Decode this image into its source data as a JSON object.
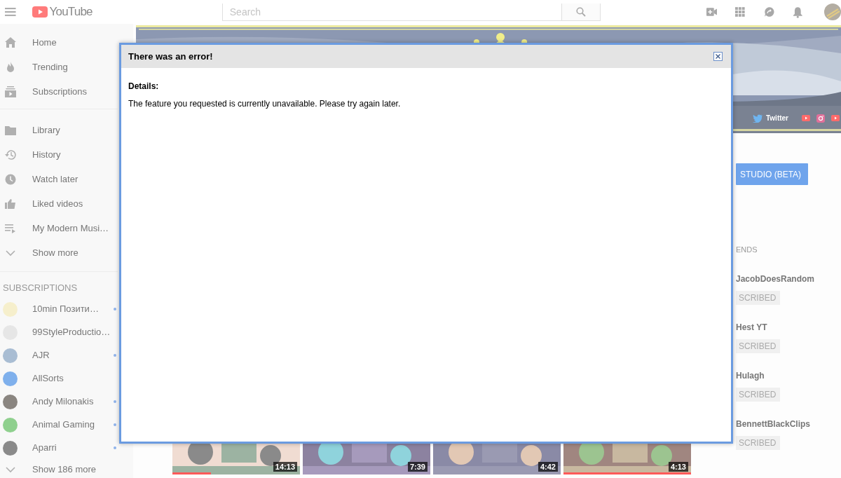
{
  "header": {
    "logo": "YouTube",
    "search_placeholder": "Search"
  },
  "sidebar": {
    "sections": [
      {
        "items": [
          {
            "kind": "home",
            "label": "Home"
          },
          {
            "kind": "trending",
            "label": "Trending"
          },
          {
            "kind": "subscriptions",
            "label": "Subscriptions"
          }
        ]
      },
      {
        "items": [
          {
            "kind": "library",
            "label": "Library"
          },
          {
            "kind": "history",
            "label": "History"
          },
          {
            "kind": "watch_later",
            "label": "Watch later"
          },
          {
            "kind": "liked",
            "label": "Liked videos"
          },
          {
            "kind": "playlist",
            "label": "My Modern Musi…"
          },
          {
            "kind": "show_more",
            "label": "Show more"
          }
        ]
      }
    ],
    "subscriptions_title": "SUBSCRIPTIONS",
    "subscriptions": [
      {
        "name": "10min Позити…",
        "new": true,
        "color": "#f6efcc"
      },
      {
        "name": "99StyleProductio…",
        "new": false,
        "color": "#e6e6e6"
      },
      {
        "name": "AJR",
        "new": true,
        "color": "#a9bdd3"
      },
      {
        "name": "AllSorts",
        "new": false,
        "color": "#7fb0ec"
      },
      {
        "name": "Andy Milonakis",
        "new": true,
        "color": "#8a8580"
      },
      {
        "name": "Animal Gaming",
        "new": true,
        "color": "#8fd08e"
      },
      {
        "name": "Aparri",
        "new": true,
        "color": "#8a8a8a"
      }
    ],
    "show_more": "Show 186 more"
  },
  "banner": {
    "links": [
      {
        "kind": "twitter",
        "label": "Twitter"
      },
      {
        "kind": "youtube"
      },
      {
        "kind": "instagram"
      },
      {
        "kind": "youtube"
      }
    ]
  },
  "studio_button": "STUDIO (BETA)",
  "featured": {
    "title": "ENDS",
    "channels": [
      {
        "name": "JacobDoesRandom",
        "button": "SCRIBED"
      },
      {
        "name": "Hest YT",
        "button": "SCRIBED"
      },
      {
        "name": "Hulagh",
        "button": "SCRIBED"
      },
      {
        "name": "BennettBlackClips",
        "button": "SCRIBED"
      }
    ]
  },
  "videos": [
    {
      "duration": "14:13",
      "level": 0.3
    },
    {
      "duration": "7:39"
    },
    {
      "duration": "4:42"
    },
    {
      "duration": "4:13",
      "level": 1
    }
  ],
  "dialog": {
    "title": "There was an error!",
    "details_label": "Details:",
    "message": "The feature you requested is currently unavailable. Please try again later."
  }
}
